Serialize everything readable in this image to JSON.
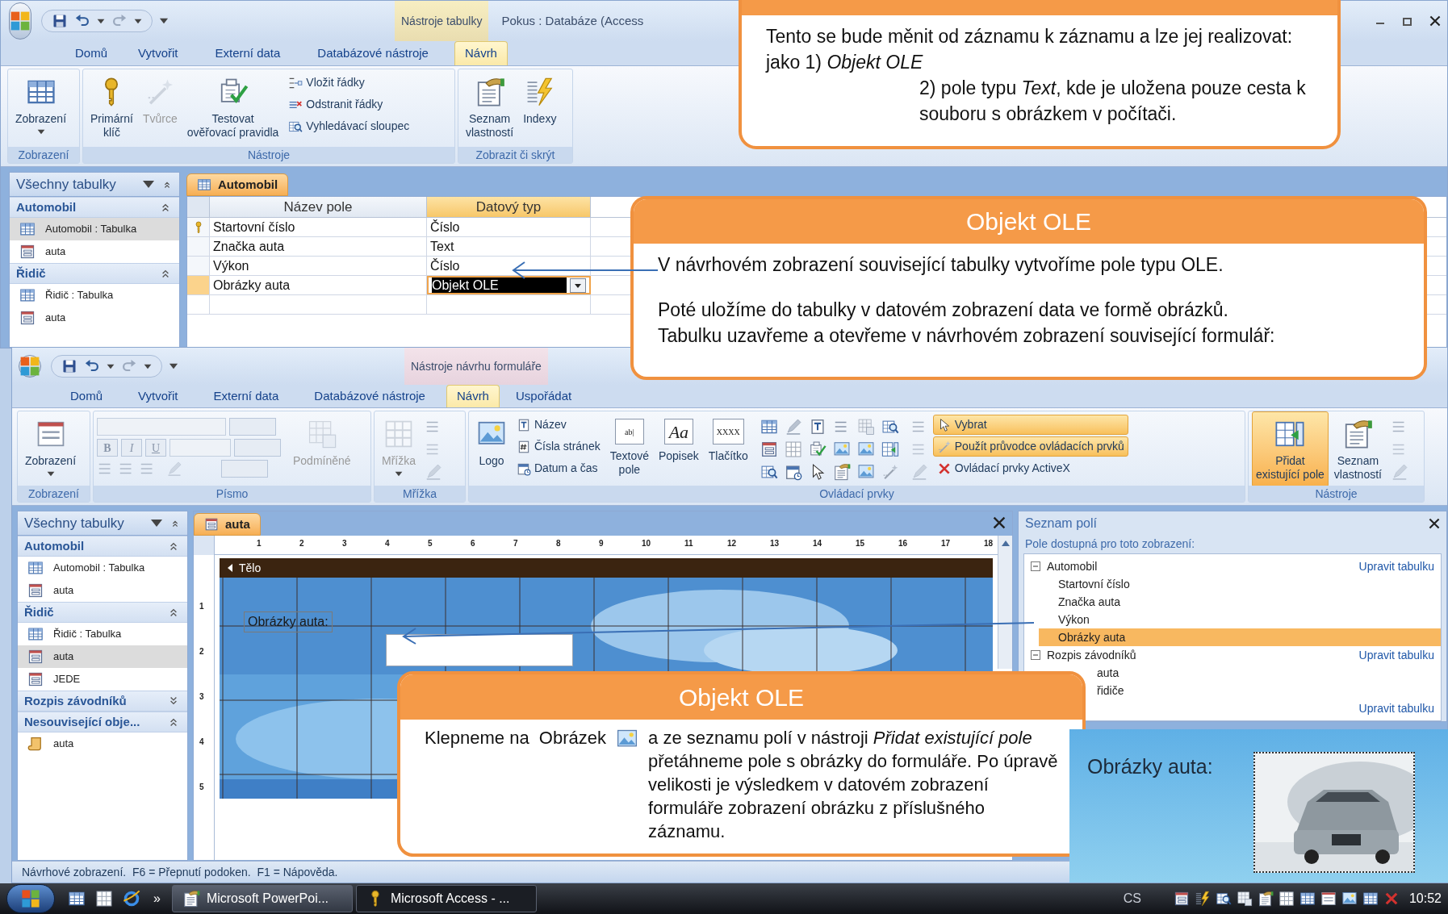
{
  "top_window": {
    "context_tab": "Nástroje tabulky",
    "title": "Pokus : Databáze (Access",
    "tabs": [
      {
        "label": "Domů",
        "selected": false
      },
      {
        "label": "Vytvořit",
        "selected": false
      },
      {
        "label": "Externí data",
        "selected": false
      },
      {
        "label": "Databázové nástroje",
        "selected": false
      },
      {
        "label": "Návrh",
        "selected": true
      }
    ],
    "ribbon": [
      {
        "label": "Zobrazení",
        "items": [
          {
            "kind": "large",
            "label": "Zobrazení",
            "dropdown": true,
            "disabled": false
          }
        ]
      },
      {
        "label": "Nástroje",
        "items": [
          {
            "kind": "large",
            "label": "Primární\nklíč",
            "disabled": false
          },
          {
            "kind": "large",
            "label": "Tvůrce",
            "disabled": true
          },
          {
            "kind": "large",
            "label": "Testovat\nověřovací pravidla",
            "disabled": false
          },
          {
            "kind": "small",
            "label": "Vložit řádky",
            "disabled": false
          },
          {
            "kind": "small",
            "label": "Odstranit řádky",
            "disabled": false
          },
          {
            "kind": "small",
            "label": "Vyhledávací sloupec",
            "disabled": false
          }
        ]
      },
      {
        "label": "Zobrazit či skrýt",
        "items": [
          {
            "kind": "large",
            "label": "Seznam\nvlastností",
            "disabled": false
          },
          {
            "kind": "large",
            "label": "Indexy",
            "disabled": false
          }
        ]
      }
    ],
    "nav": {
      "title": "Všechny tabulky",
      "groups": [
        {
          "label": "Automobil",
          "expanded": true,
          "items": [
            {
              "label": "Automobil : Tabulka",
              "kind": "table",
              "selected": true
            },
            {
              "label": "auta",
              "kind": "form",
              "selected": false
            }
          ]
        },
        {
          "label": "Řidič",
          "expanded": true,
          "items": [
            {
              "label": "Řidič : Tabulka",
              "kind": "table",
              "selected": false
            },
            {
              "label": "auta",
              "kind": "form",
              "selected": false
            }
          ]
        }
      ]
    },
    "document_tab": "Automobil",
    "columns": [
      "Název pole",
      "Datový typ"
    ],
    "rows": [
      {
        "field": "Startovní číslo",
        "type": "Číslo",
        "primary_key": true,
        "selected": false
      },
      {
        "field": "Značka auta",
        "type": "Text",
        "primary_key": false,
        "selected": false
      },
      {
        "field": "Výkon",
        "type": "Číslo",
        "primary_key": false,
        "selected": false
      },
      {
        "field": "Obrázky auta",
        "type": "Objekt OLE",
        "primary_key": false,
        "selected": true
      }
    ]
  },
  "bottom_window": {
    "context_tab": "Nástroje návrhu formuláře",
    "tabs": [
      {
        "label": "Domů",
        "selected": false
      },
      {
        "label": "Vytvořit",
        "selected": false
      },
      {
        "label": "Externí data",
        "selected": false
      },
      {
        "label": "Databázové nástroje",
        "selected": false
      },
      {
        "label": "Návrh",
        "selected": true
      },
      {
        "label": "Uspořádat",
        "selected": false
      }
    ],
    "ribbon": [
      {
        "label": "Zobrazení",
        "items": [
          {
            "kind": "large",
            "label": "Zobrazení",
            "dropdown": true,
            "disabled": false,
            "on": false
          }
        ]
      },
      {
        "label": "Písmo",
        "items": [
          {
            "kind": "font_tools",
            "buttons": [
              "B",
              "I",
              "U"
            ]
          },
          {
            "kind": "large",
            "label": "Podmíněné",
            "disabled": true,
            "on": false
          }
        ]
      },
      {
        "label": "Mřížka",
        "items": [
          {
            "kind": "large",
            "label": "Mřížka",
            "dropdown": true,
            "disabled": true,
            "on": false
          },
          {
            "kind": "icon_column"
          }
        ]
      },
      {
        "label": "Ovládací prvky",
        "items": [
          {
            "kind": "large",
            "label": "Logo",
            "disabled": false,
            "on": false
          },
          {
            "kind": "small",
            "label": "Název",
            "disabled": false,
            "on": false
          },
          {
            "kind": "small",
            "label": "Čísla stránek",
            "disabled": false,
            "on": false
          },
          {
            "kind": "small",
            "label": "Datum a čas",
            "disabled": false,
            "on": false
          },
          {
            "kind": "large",
            "label": "Textové\npole",
            "icon_text": "ab|",
            "disabled": false,
            "on": false
          },
          {
            "kind": "large",
            "label": "Popisek",
            "icon_text": "Aa",
            "disabled": false,
            "on": false
          },
          {
            "kind": "large",
            "label": "Tlačítko",
            "icon_text": "XXXX",
            "disabled": false,
            "on": false
          },
          {
            "kind": "tool_grid"
          },
          {
            "kind": "icon_column"
          },
          {
            "kind": "small",
            "label": "Vybrat",
            "disabled": false,
            "on": true
          },
          {
            "kind": "small",
            "label": "Použít průvodce ovládacích prvků",
            "disabled": false,
            "on": true
          },
          {
            "kind": "small",
            "label": "Ovládací prvky ActiveX",
            "disabled": false,
            "on": false
          }
        ]
      },
      {
        "label": "Nástroje",
        "items": [
          {
            "kind": "large",
            "label": "Přidat\nexistující pole",
            "disabled": false,
            "on": true
          },
          {
            "kind": "large",
            "label": "Seznam\nvlastností",
            "disabled": false,
            "on": false
          },
          {
            "kind": "icon_column"
          }
        ]
      }
    ],
    "nav": {
      "title": "Všechny tabulky",
      "groups": [
        {
          "label": "Automobil",
          "expanded": true,
          "items": [
            {
              "label": "Automobil : Tabulka",
              "kind": "table",
              "selected": false
            },
            {
              "label": "auta",
              "kind": "form",
              "selected": false
            }
          ]
        },
        {
          "label": "Řidič",
          "expanded": true,
          "items": [
            {
              "label": "Řidič : Tabulka",
              "kind": "table",
              "selected": false
            },
            {
              "label": "auta",
              "kind": "form",
              "selected": true
            },
            {
              "label": "JEDE",
              "kind": "form",
              "selected": false
            }
          ]
        },
        {
          "label": "Rozpis závodníků",
          "expanded": false
        },
        {
          "label": "Nesouvisející obje...",
          "expanded": true,
          "items": [
            {
              "label": "auta",
              "kind": "macro",
              "selected": false
            }
          ]
        }
      ]
    },
    "document_tab": "auta",
    "ruler_marks": [
      "1",
      "2",
      "3",
      "4",
      "5",
      "6",
      "7",
      "8",
      "9",
      "10",
      "11",
      "12",
      "13",
      "14",
      "15",
      "16",
      "17",
      "18"
    ],
    "vertical_marks": [
      "1",
      "2",
      "3",
      "4",
      "5"
    ],
    "section": "Tělo",
    "label": "Obrázky auta:",
    "field_list": {
      "title": "Seznam polí",
      "subtitle": "Pole dostupná pro toto zobrazení:",
      "tables": [
        {
          "name": "Automobil",
          "expanded": true,
          "action": "Upravit tabulku",
          "fields": [
            {
              "label": "Startovní číslo",
              "selected": false
            },
            {
              "label": "Značka auta",
              "selected": false
            },
            {
              "label": "Výkon",
              "selected": false
            },
            {
              "label": "Obrázky auta",
              "selected": true
            }
          ]
        },
        {
          "name": "Rozpis závodníků",
          "expanded": true,
          "action": "Upravit tabulku",
          "fields": [
            {
              "label": "auta",
              "selected": false
            },
            {
              "label": "řidiče",
              "selected": false
            }
          ]
        },
        {
          "action": "Upravit tabulku"
        }
      ]
    },
    "status_bar": "Návrhové zobrazení.  F6 = Přepnutí podoken.  F1 = Nápověda."
  },
  "taskbar": {
    "more": "»",
    "buttons": [
      {
        "label": "Microsoft PowerPoi...",
        "selected": false
      },
      {
        "label": "Microsoft Access - ...",
        "selected": true
      }
    ],
    "language": "CS",
    "clock": "10:52"
  },
  "callouts": [
    {
      "paragraphs": [
        "Tento se bude měnit od záznamu k záznamu a lze jej realizovat: jako 1) *Objekt OLE*",
        "2) pole typu *Text*, kde je uložena pouze cesta k souboru s obrázkem v počítači."
      ]
    },
    {
      "title": "Objekt OLE",
      "paragraphs": [
        "V návrhovém zobrazení související tabulky vytvoříme pole typu OLE.",
        "Poté uložíme do tabulky  v datovém zobrazení data ve formě obrázků.",
        "Tabulku uzavřeme a otevřeme v návrhovém zobrazení související formulář:"
      ]
    },
    {
      "title": "Objekt OLE",
      "lead": "Klepneme na  Obrázek",
      "paragraphs": [
        "a ze seznamu polí v nástroji *Přidat existující pole* přetáhneme pole s obrázky do formuláře. Po úpravě velikosti je výsledkem v datovém  zobrazení formuláře zobrazení obrázku z příslušného záznamu."
      ]
    }
  ],
  "result": {
    "label": "Obrázky auta:"
  }
}
